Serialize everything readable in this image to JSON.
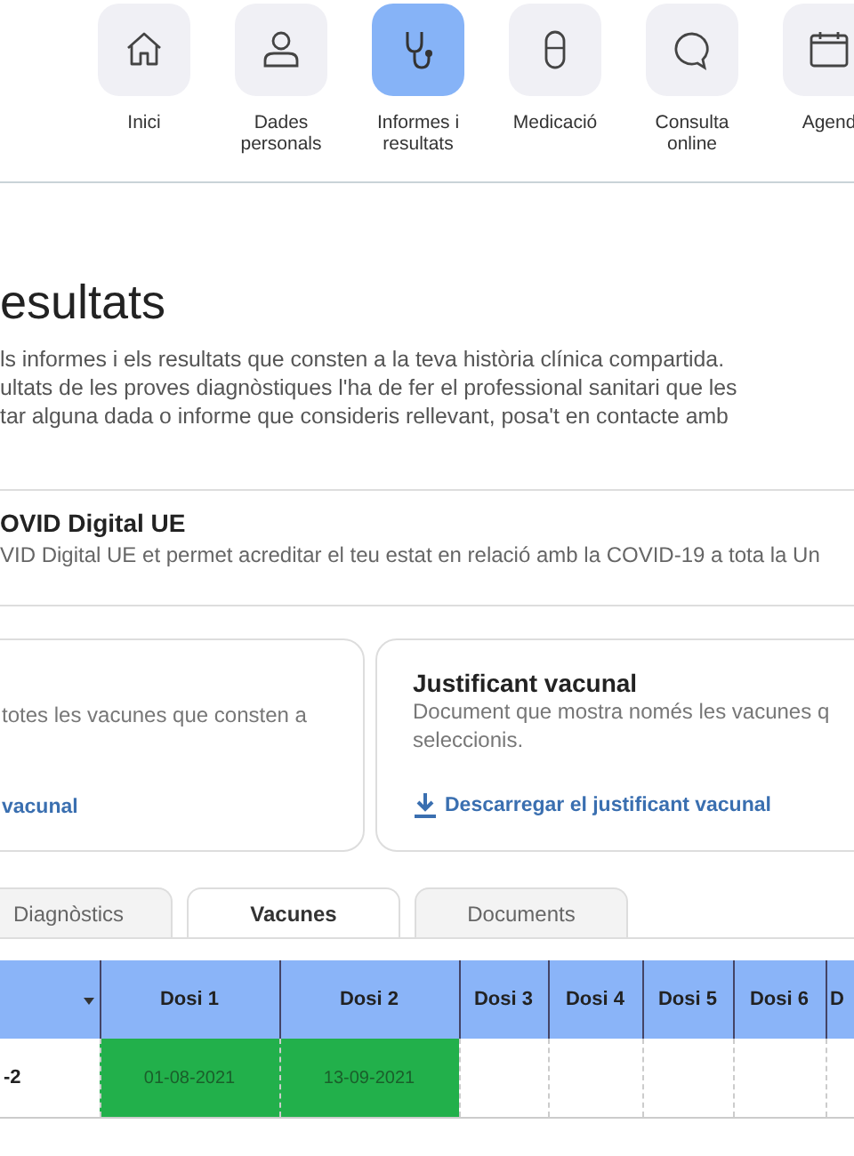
{
  "nav": [
    {
      "label": "Inici",
      "selected": false
    },
    {
      "label": "Dades personals",
      "selected": false
    },
    {
      "label": "Informes i resultats",
      "selected": true
    },
    {
      "label": "Medicació",
      "selected": false
    },
    {
      "label": "Consulta online",
      "selected": false
    },
    {
      "label": "Agend",
      "selected": false
    }
  ],
  "title": "esultats",
  "intro": [
    "ls informes i els resultats que consten a la teva història clínica compartida.",
    "ultats de les proves diagnòstiques l'ha de fer el professional sanitari que les",
    "tar alguna dada o informe que consideris rellevant, posa't en contacte amb"
  ],
  "covid": {
    "title": "OVID Digital UE",
    "text": "VID Digital UE et permet acreditar el teu estat en relació amb la COVID-19 a tota la Un"
  },
  "cards": [
    {
      "text": [
        "totes les vacunes que consten a"
      ],
      "link": "vacunal"
    },
    {
      "title": "Justificant vacunal",
      "text": [
        "Document que mostra només les vacunes q",
        "seleccionis."
      ],
      "link": "Descarregar el justificant vacunal"
    }
  ],
  "tabs": [
    {
      "label": "Diagnòstics",
      "selected": false
    },
    {
      "label": "Vacunes",
      "selected": true
    },
    {
      "label": "Documents",
      "selected": false
    }
  ],
  "table": {
    "columns": [
      "Dosi 1",
      "Dosi 2",
      "Dosi 3",
      "Dosi 4",
      "Dosi 5",
      "Dosi 6",
      "D"
    ],
    "rows": [
      {
        "name": "-2",
        "doses": [
          {
            "date": "01-08-2021",
            "given": true
          },
          {
            "date": "13-09-2021",
            "given": true
          },
          {
            "given": false
          },
          {
            "given": false
          },
          {
            "given": false
          },
          {
            "given": false
          },
          {
            "given": false
          }
        ]
      }
    ]
  }
}
